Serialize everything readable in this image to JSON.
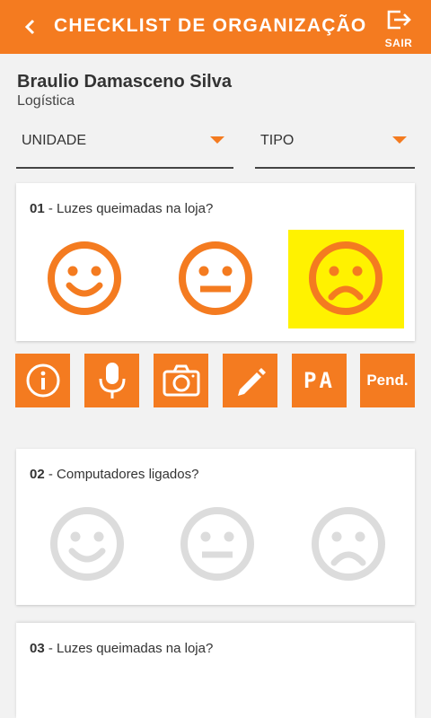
{
  "header": {
    "title": "CHECKLIST DE ORGANIZAÇÃO",
    "exit_label": "SAIR"
  },
  "user": {
    "name": "Braulio Damasceno Silva",
    "department": "Logística"
  },
  "filters": {
    "unidade": "UNIDADE",
    "tipo": "TIPO"
  },
  "questions": [
    {
      "number": "01",
      "text": " - Luzes queimadas na loja?",
      "selected": "sad"
    },
    {
      "number": "02",
      "text": " - Computadores ligados?",
      "selected": ""
    },
    {
      "number": "03",
      "text": " - Luzes queimadas na loja?",
      "selected": ""
    }
  ],
  "actions": {
    "pa_label": "PA",
    "pend_label": "Pend."
  },
  "colors": {
    "accent": "#f47b20",
    "highlight": "#fff200",
    "inactive": "#dcdcdc"
  }
}
